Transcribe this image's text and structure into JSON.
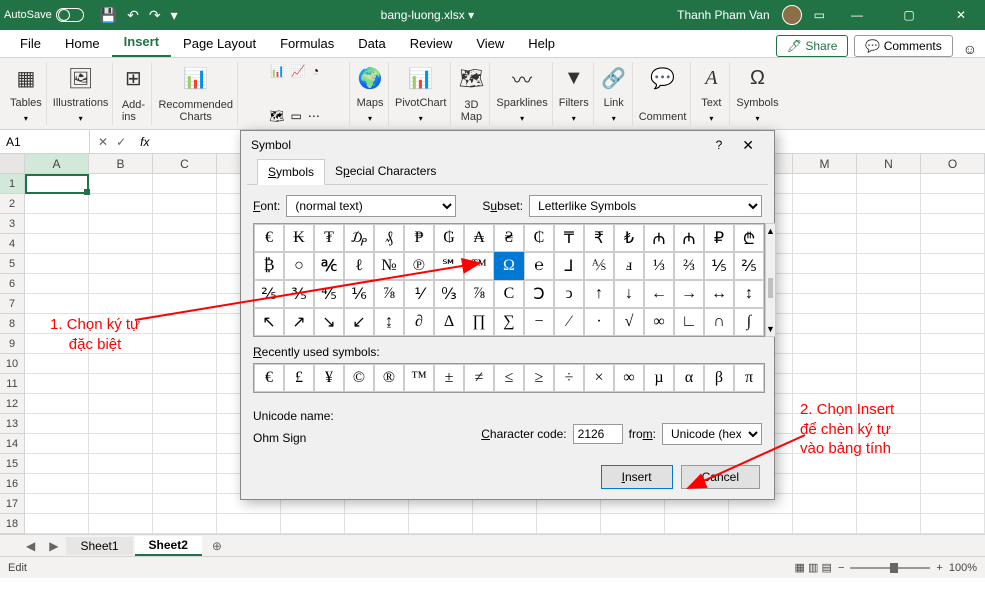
{
  "titlebar": {
    "autosave": "AutoSave",
    "filename": "bang-luong.xlsx",
    "username": "Thanh Pham Van"
  },
  "tabs": {
    "file": "File",
    "home": "Home",
    "insert": "Insert",
    "pagelayout": "Page Layout",
    "formulas": "Formulas",
    "data": "Data",
    "review": "Review",
    "view": "View",
    "help": "Help",
    "share": "Share",
    "comments": "Comments"
  },
  "ribbon": {
    "tables": "Tables",
    "illustrations": "Illustrations",
    "addins": "Add-\nins",
    "recommended": "Recommended\nCharts",
    "maps": "Maps",
    "pivotchart": "PivotChart",
    "map3d": "3D\nMap",
    "sparklines": "Sparklines",
    "filters": "Filters",
    "link": "Link",
    "comment": "Comment",
    "text": "Text",
    "symbols": "Symbols"
  },
  "namebox": "A1",
  "columns": [
    "A",
    "B",
    "C",
    "",
    "",
    "",
    "",
    "",
    "",
    "",
    "",
    "",
    "M",
    "N",
    "O"
  ],
  "rows_count": 18,
  "sheets": {
    "s1": "Sheet1",
    "s2": "Sheet2"
  },
  "status": {
    "mode": "Edit",
    "zoom": "100%"
  },
  "dialog": {
    "title": "Symbol",
    "tab_symbols": "Symbols",
    "tab_special": "Special Characters",
    "font_label": "Font:",
    "font_value": "(normal text)",
    "subset_label": "Subset:",
    "subset_value": "Letterlike Symbols",
    "grid": [
      [
        "€",
        "₭",
        "₮",
        "₯",
        "₰",
        "₱",
        "₲",
        "₳",
        "₴",
        "₵",
        "₸",
        "₹",
        "₺",
        "₼",
        "₼",
        "₽",
        "₾"
      ],
      [
        "₿",
        "○",
        "℀",
        "ℓ",
        "№",
        "℗",
        "℠",
        "™",
        "Ω",
        "℮",
        "⅃",
        "⅍",
        "ⅎ",
        "⅓",
        "⅔",
        "⅕",
        "⅖"
      ],
      [
        "⅖",
        "⅗",
        "⅘",
        "⅙",
        "⅞",
        "⅟",
        "↉",
        "⅞",
        "C",
        "Ↄ",
        "ↄ",
        "↑",
        "↓",
        "←",
        "→",
        "↔",
        "↕"
      ],
      [
        "↖",
        "↗",
        "↘",
        "↙",
        "↨",
        "∂",
        "∆",
        "∏",
        "∑",
        "−",
        "∕",
        "∙",
        "√",
        "∞",
        "∟",
        "∩",
        "∫"
      ]
    ],
    "selected_row": 1,
    "selected_col": 8,
    "recent_label": "Recently used symbols:",
    "recent": [
      "€",
      "£",
      "¥",
      "©",
      "®",
      "™",
      "±",
      "≠",
      "≤",
      "≥",
      "÷",
      "×",
      "∞",
      "µ",
      "α",
      "β",
      "π"
    ],
    "unicode_label": "Unicode name:",
    "unicode_name": "Ohm Sign",
    "charcode_label": "Character code:",
    "charcode_value": "2126",
    "from_label": "from:",
    "from_value": "Unicode (hex)",
    "insert": "Insert",
    "cancel": "Cancel"
  },
  "annotations": {
    "a1": "1. Chọn ký tự\nđặc biệt",
    "a2": "2. Chọn Insert\nđể chèn ký tự\nvào bảng tính"
  }
}
